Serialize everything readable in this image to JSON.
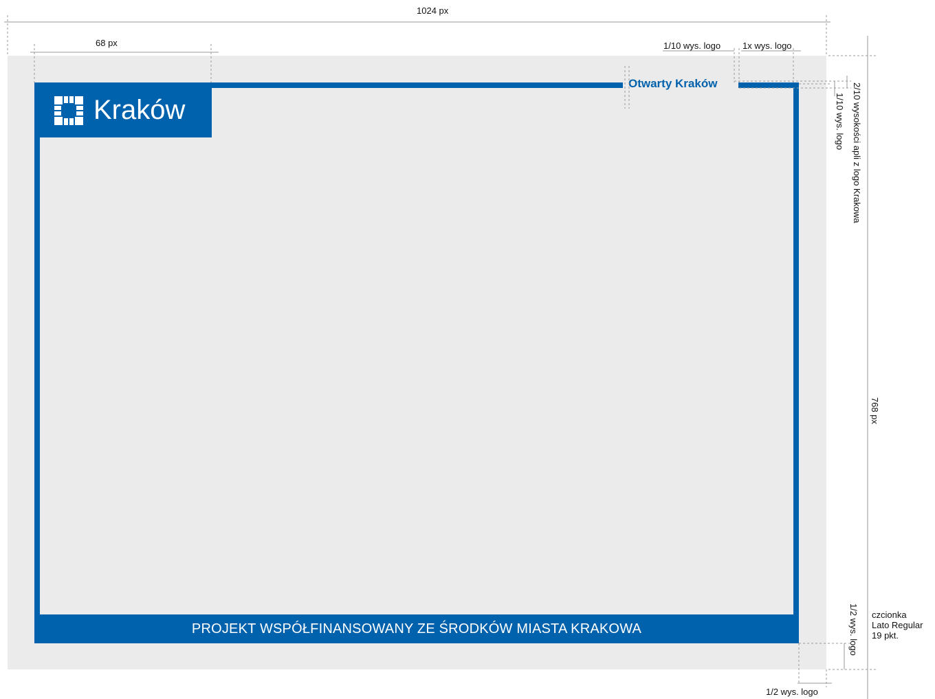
{
  "logo": {
    "name": "Kraków"
  },
  "open_label": "Otwarty Kraków",
  "footer": {
    "text": "PROJEKT WSPÓŁFINANSOWANY ZE ŚRODKÓW MIASTA  KRAKOWA"
  },
  "dimensions": {
    "width": "1024 px",
    "logo_width": "68 px",
    "height": "768 px",
    "tenth_logo_height": "1/10 wys. logo",
    "one_logo_height": "1x wys. logo",
    "two_tenths_band": "2/10 wysokości apli z logo Krakowa",
    "tenth_logo_height_vertical": "1/10 wys. logo",
    "half_logo_height_vertical": "1/2 wys. logo",
    "half_logo_height": "1/2 wys. logo"
  },
  "font_note": {
    "line1": "czcionka",
    "line2": "Lato Regular",
    "line3": "19 pkt."
  },
  "colors": {
    "brand_blue": "#0061ad",
    "canvas_gray": "#ebebeb"
  }
}
